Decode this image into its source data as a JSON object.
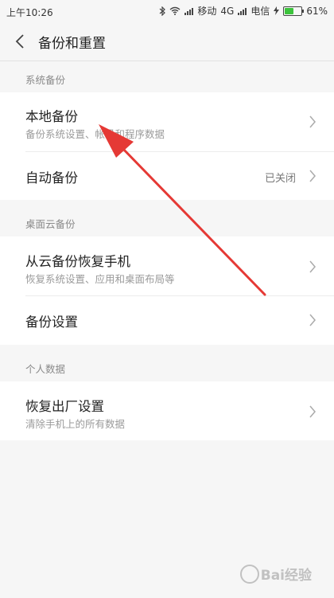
{
  "status_bar": {
    "time": "上午10:26",
    "carrier1": "移动",
    "network": "4G",
    "carrier2": "电信",
    "battery": "61%",
    "battery_level": 0.61,
    "icons": [
      "bluetooth-icon",
      "wifi-icon",
      "signal-icon",
      "charging-icon",
      "battery-icon"
    ]
  },
  "header": {
    "title": "备份和重置",
    "back_icon": "back-chevron-icon"
  },
  "sections": [
    {
      "label": "系统备份",
      "rows": [
        {
          "title": "本地备份",
          "subtitle": "备份系统设置、帐号和程序数据"
        },
        {
          "title": "自动备份",
          "value": "已关闭"
        }
      ]
    },
    {
      "label": "桌面云备份",
      "rows": [
        {
          "title": "从云备份恢复手机",
          "subtitle": "恢复系统设置、应用和桌面布局等"
        },
        {
          "title": "备份设置"
        }
      ]
    },
    {
      "label": "个人数据",
      "rows": [
        {
          "title": "恢复出厂设置",
          "subtitle": "清除手机上的所有数据"
        }
      ]
    }
  ],
  "watermark": {
    "text": "Bai经验",
    "icon": "baidu-paw-icon"
  },
  "colors": {
    "background": "#f6f6f6",
    "card": "#ffffff",
    "annotation": "#e53935",
    "battery_fill": "#3cc33c"
  }
}
